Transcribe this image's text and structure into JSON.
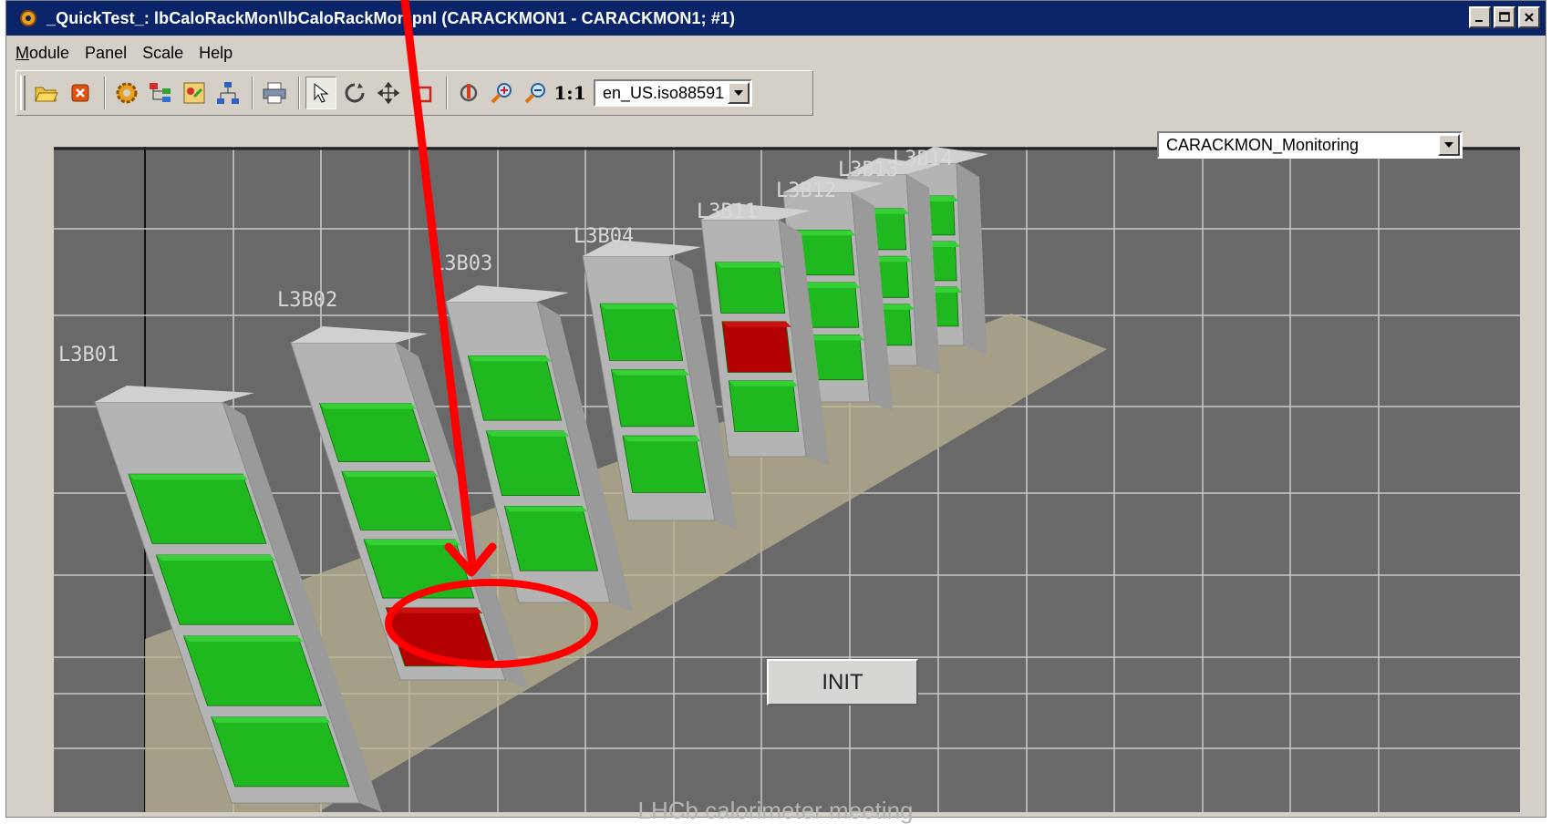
{
  "window": {
    "title": "_QuickTest_: lbCaloRackMon\\lbCaloRackMon.pnl (CARACKMON1 - CARACKMON1; #1)"
  },
  "menu": [
    {
      "label": "Module",
      "mnemonic": "M"
    },
    {
      "label": "Panel",
      "mnemonic": ""
    },
    {
      "label": "Scale",
      "mnemonic": ""
    },
    {
      "label": "Help",
      "mnemonic": ""
    }
  ],
  "toolbar": {
    "scale_label": "1:1",
    "locale_value": "en_US.iso88591"
  },
  "panel_selector": {
    "value": "CARACKMON_Monitoring"
  },
  "racks": [
    {
      "label": "L3B01",
      "status": "ok"
    },
    {
      "label": "L3B02",
      "status": "alarm"
    },
    {
      "label": "L3B03",
      "status": "ok"
    },
    {
      "label": "L3B04",
      "status": "ok"
    },
    {
      "label": "L3B11",
      "status": "alarm"
    },
    {
      "label": "L3B12",
      "status": "ok"
    },
    {
      "label": "L3B13",
      "status": "ok"
    },
    {
      "label": "L3B14",
      "status": "ok"
    }
  ],
  "init_button": {
    "label": "INIT"
  },
  "footer": {
    "text": "LHCb calorimeter meeting"
  },
  "colors": {
    "titlebar": "#0a246a",
    "canvas_bg": "#696969",
    "crate_ok": "#1fb81f",
    "crate_alarm": "#b30000",
    "annotation": "#ff0000"
  }
}
